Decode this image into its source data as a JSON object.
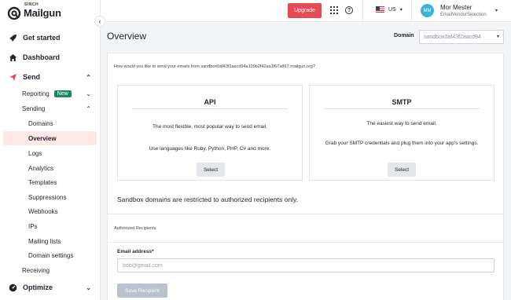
{
  "brand": {
    "sinch_label": "SINCH",
    "name": "Mailgun"
  },
  "sidebar": {
    "collapse_icon": "chevron-left-icon",
    "items": [
      {
        "label": "Get started",
        "icon": "rocket-icon"
      },
      {
        "label": "Dashboard",
        "icon": "home-icon"
      },
      {
        "label": "Send",
        "icon": "paper-plane-icon",
        "expanded": true
      },
      {
        "label": "Reporting",
        "badge": "New"
      },
      {
        "label": "Sending",
        "expanded": true
      },
      {
        "label": "Domains"
      },
      {
        "label": "Overview",
        "active": true
      },
      {
        "label": "Logs"
      },
      {
        "label": "Analytics"
      },
      {
        "label": "Templates"
      },
      {
        "label": "Suppressions"
      },
      {
        "label": "Webhooks"
      },
      {
        "label": "IPs"
      },
      {
        "label": "Mailing lists"
      },
      {
        "label": "Domain settings"
      },
      {
        "label": "Receiving"
      },
      {
        "label": "Optimize",
        "icon": "gauge-icon"
      }
    ]
  },
  "topbar": {
    "upgrade_label": "Upgrade",
    "region": "US",
    "user": {
      "initials": "MM",
      "name": "Mor Mester",
      "org": "EmailVendorSelection"
    }
  },
  "main": {
    "title": "Overview",
    "domain_label": "Domain",
    "domain_value": "sandbox0af43f2aacd94",
    "question": "How would you like to send your emails from sandbox0af43f2aacd94a109b2f42aa1f67a867.mailgun.org?",
    "api": {
      "title": "API",
      "line1": "The most flexible, most popular way to send email.",
      "line2": "Use languages like Ruby, Python, PHP, C# and more.",
      "button": "Select"
    },
    "smtp": {
      "title": "SMTP",
      "line1": "The easiest way to send email.",
      "line2": "Grab your SMTP credentials and plug them into your app's settings.",
      "button": "Select"
    },
    "sandbox_note": "Sandbox domains are restricted to authorized recipients only.",
    "authorized": {
      "title": "Authorized Recipients",
      "email_label": "Email address*",
      "email_placeholder": "bob@gmail.com",
      "email_value": "",
      "save_label": "Save Recipient"
    }
  },
  "colors": {
    "accent": "#e54a55",
    "active_bg": "#fde8e8",
    "badge": "#1d8a5d",
    "avatar": "#3db3d9"
  }
}
